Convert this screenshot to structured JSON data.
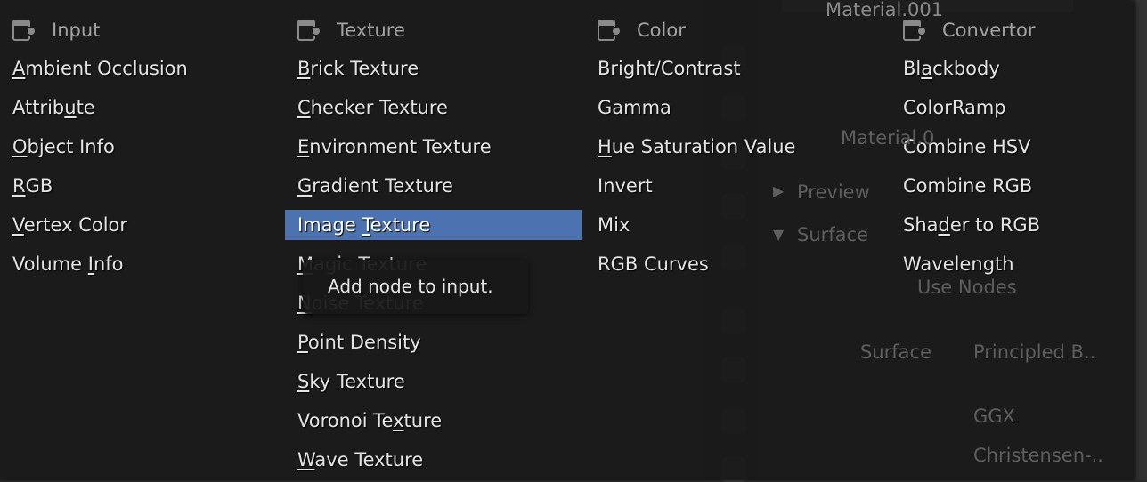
{
  "background_panel": {
    "material_top": "Material.001",
    "material_slot": "Material.0",
    "preview": "Preview",
    "surface_section": "Surface",
    "use_nodes": "Use Nodes",
    "surface_label": "Surface",
    "surface_value": "Principled B..",
    "distribution": "GGX",
    "subsurface": "Christensen-.."
  },
  "menu": {
    "highlight_color": "#4d72b0",
    "columns": [
      {
        "header": "Input",
        "icon": "node-socket-icon",
        "items": [
          {
            "label": "Ambient Occlusion",
            "accel": 0
          },
          {
            "label": "Attribute",
            "accel": 6
          },
          {
            "label": "Object Info",
            "accel": 0
          },
          {
            "label": "RGB",
            "accel": 0
          },
          {
            "label": "Vertex Color",
            "accel": 0
          },
          {
            "label": "Volume Info",
            "accel": 7
          }
        ]
      },
      {
        "header": "Texture",
        "icon": "node-socket-icon",
        "items": [
          {
            "label": "Brick Texture",
            "accel": 0
          },
          {
            "label": "Checker Texture",
            "accel": 0
          },
          {
            "label": "Environment Texture",
            "accel": 0
          },
          {
            "label": "Gradient Texture",
            "accel": 0
          },
          {
            "label": "Image Texture",
            "accel": 6,
            "highlighted": true
          },
          {
            "label": "Magic Texture",
            "accel": 0
          },
          {
            "label": "Noise Texture",
            "accel": 0
          },
          {
            "label": "Point Density",
            "accel": 0
          },
          {
            "label": "Sky Texture",
            "accel": 0
          },
          {
            "label": "Voronoi Texture",
            "accel": 10
          },
          {
            "label": "Wave Texture",
            "accel": 0
          }
        ]
      },
      {
        "header": "Color",
        "icon": "node-socket-icon",
        "items": [
          {
            "label": "Bright/Contrast",
            "accel": -1
          },
          {
            "label": "Gamma",
            "accel": -1
          },
          {
            "label": "Hue Saturation Value",
            "accel": 0
          },
          {
            "label": "Invert",
            "accel": -1
          },
          {
            "label": "Mix",
            "accel": -1
          },
          {
            "label": "RGB Curves",
            "accel": -1
          }
        ]
      },
      {
        "header": "Convertor",
        "icon": "node-socket-icon",
        "items": [
          {
            "label": "Blackbody",
            "accel": 2
          },
          {
            "label": "ColorRamp",
            "accel": -1
          },
          {
            "label": "Combine HSV",
            "accel": -1
          },
          {
            "label": "Combine RGB",
            "accel": -1
          },
          {
            "label": "Shader to RGB",
            "accel": 3
          },
          {
            "label": "Wavelength",
            "accel": -1
          }
        ]
      }
    ]
  },
  "tooltip": {
    "text": "Add node to input."
  }
}
